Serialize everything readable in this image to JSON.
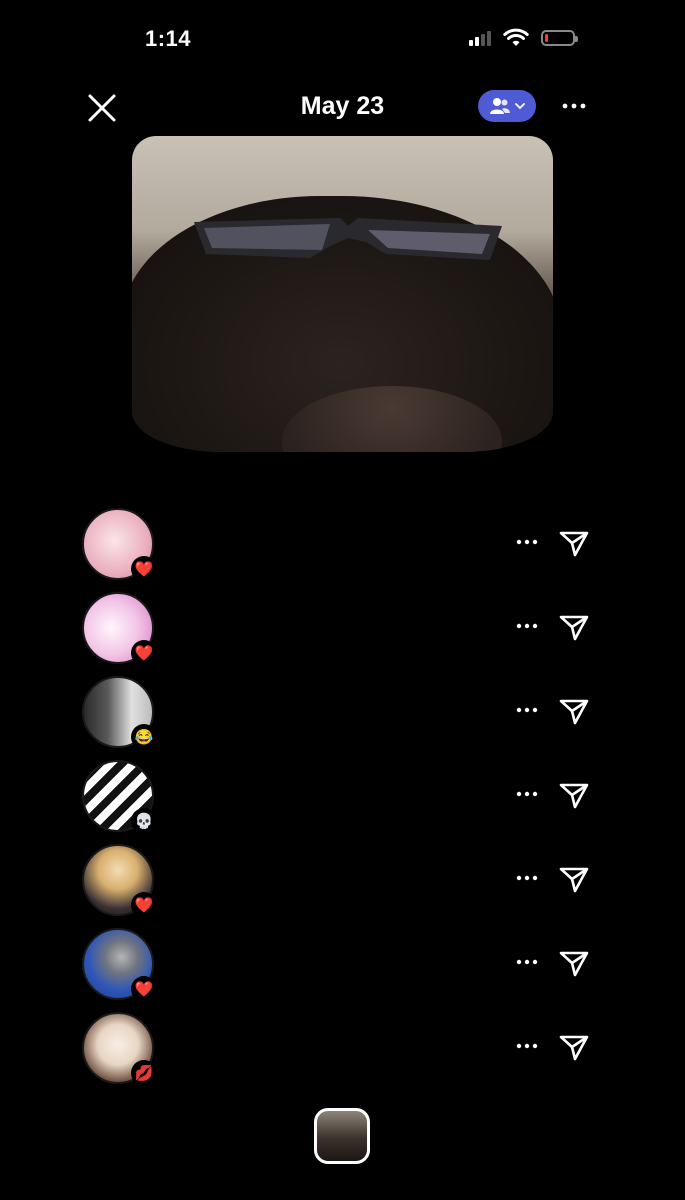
{
  "status_bar": {
    "time": "1:14",
    "battery_level": 0.1,
    "battery_color": "#ff3b30"
  },
  "header": {
    "title": "May 23",
    "close_icon": "close-icon",
    "audience_icon": "people-icon",
    "audience_color": "#4f5bd5",
    "more_icon": "more-icon"
  },
  "story": {
    "thumbnail_label": "story-thumbnail"
  },
  "viewers": [
    {
      "username": "",
      "reaction": "❤️",
      "avatar_colors": [
        "#f3d6d8",
        "#e9a9b8"
      ]
    },
    {
      "username": "",
      "reaction": "❤️",
      "avatar_colors": [
        "#fdf0f6",
        "#d679c7"
      ]
    },
    {
      "username": "",
      "reaction": "😂",
      "avatar_colors": [
        "#d7d7d7",
        "#3a3a3a"
      ]
    },
    {
      "username": "",
      "reaction": "💀",
      "avatar_colors": [
        "#ffffff",
        "#101010"
      ]
    },
    {
      "username": "",
      "reaction": "❤️",
      "avatar_colors": [
        "#e7c58c",
        "#1f1a20"
      ]
    },
    {
      "username": "",
      "reaction": "❤️",
      "avatar_colors": [
        "#2349a6",
        "#9b9b9b"
      ]
    },
    {
      "username": "",
      "reaction": "💋",
      "avatar_colors": [
        "#f4ece2",
        "#6b4a3a"
      ]
    }
  ],
  "row_icons": {
    "more": "more-icon",
    "share": "paper-plane-icon"
  }
}
